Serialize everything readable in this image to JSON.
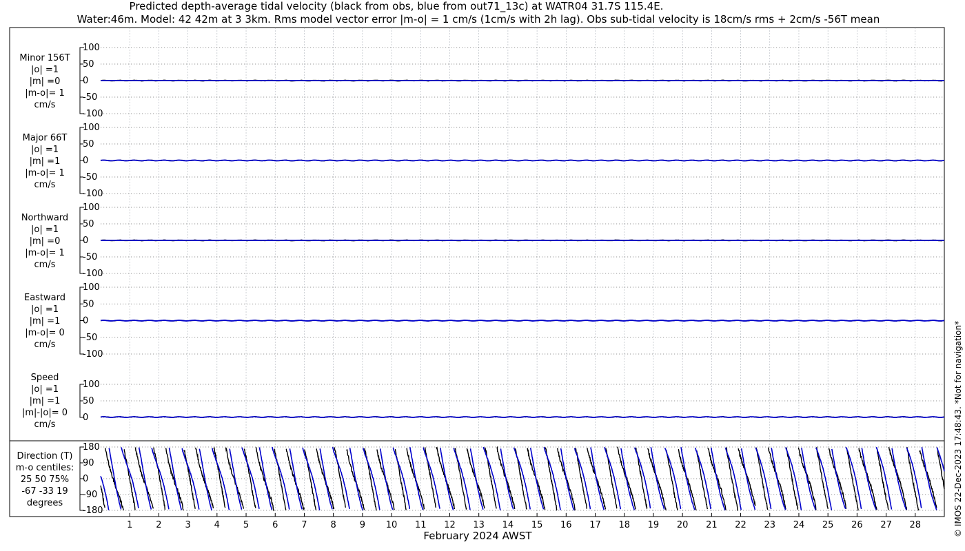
{
  "chart_data": {
    "type": "line",
    "title_line1": "Predicted depth-average tidal velocity (black from obs, blue from out71_13c) at WATR04 31.7S 115.4E.",
    "title_line2": "Water:46m. Model: 42 42m at 3 3km. Rms model vector error |m-o| = 1 cm/s (1cm/s with 2h lag). Obs sub-tidal velocity is 18cm/s rms + 2cm/s -56T mean",
    "xlabel": "February 2024 AWST",
    "x_ticks": [
      "1",
      "2",
      "3",
      "4",
      "5",
      "6",
      "7",
      "8",
      "9",
      "10",
      "11",
      "12",
      "13",
      "14",
      "15",
      "16",
      "17",
      "18",
      "19",
      "20",
      "21",
      "22",
      "23",
      "24",
      "25",
      "26",
      "27",
      "28"
    ],
    "copyright": "© IMOS 22-Dec-2023 17:48:43. *Not for navigation*",
    "colors": {
      "obs": "#000000",
      "model": "#0000cc"
    },
    "panels": [
      {
        "key": "minor",
        "label_lines": [
          "Minor 156T",
          "|o| =1",
          "|m| =0",
          "|m-o|= 1",
          "cm/s"
        ],
        "yticks": [
          "100",
          "50",
          "0",
          "-50",
          "-100"
        ],
        "ylim": [
          -100,
          100
        ],
        "obs_amp": 1,
        "model_amp": 0
      },
      {
        "key": "major",
        "label_lines": [
          "Major 66T",
          "|o| =1",
          "|m| =1",
          "|m-o|= 1",
          "cm/s"
        ],
        "yticks": [
          "100",
          "50",
          "0",
          "-50",
          "-100"
        ],
        "ylim": [
          -100,
          100
        ],
        "obs_amp": 1,
        "model_amp": 1
      },
      {
        "key": "north",
        "label_lines": [
          "Northward",
          "|o| =1",
          "|m| =0",
          "|m-o|= 1",
          "cm/s"
        ],
        "yticks": [
          "100",
          "50",
          "0",
          "-50",
          "-100"
        ],
        "ylim": [
          -100,
          100
        ],
        "obs_amp": 1,
        "model_amp": 0
      },
      {
        "key": "east",
        "label_lines": [
          "Eastward",
          "|o| =1",
          "|m| =1",
          "|m-o|= 0",
          "cm/s"
        ],
        "yticks": [
          "100",
          "50",
          "0",
          "-50",
          "-100"
        ],
        "ylim": [
          -100,
          100
        ],
        "obs_amp": 1,
        "model_amp": 1
      },
      {
        "key": "speed",
        "label_lines": [
          "Speed",
          "|o| =1",
          "|m| =1",
          "|m|-|o|= 0",
          "cm/s"
        ],
        "yticks": [
          "100",
          "50",
          "0"
        ],
        "ylim": [
          0,
          100
        ],
        "obs_amp": 1,
        "model_amp": 1
      },
      {
        "key": "direction",
        "label_lines": [
          "Direction (T)",
          "m-o centiles:",
          "25  50  75%",
          "-67 -33  19",
          "degrees"
        ],
        "yticks": [
          "180",
          "90",
          "0",
          "-90",
          "-180"
        ],
        "ylim": [
          -180,
          180
        ]
      }
    ],
    "x_range_days": [
      0,
      29
    ],
    "grid": true
  }
}
